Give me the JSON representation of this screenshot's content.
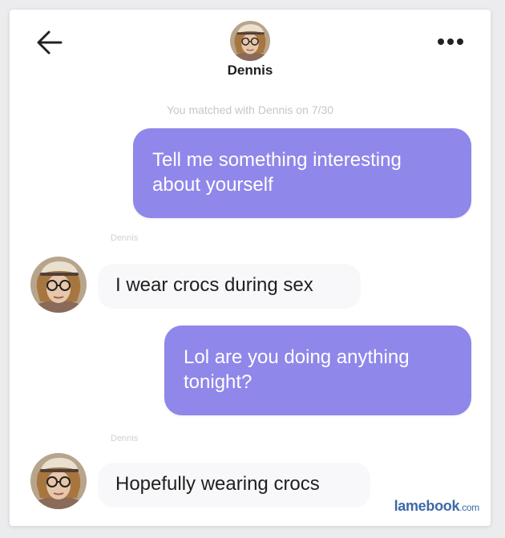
{
  "header": {
    "contact_name": "Dennis",
    "back_icon": "arrow-left-icon",
    "menu_icon": "more-horizontal-icon"
  },
  "chat": {
    "match_note": "You matched with Dennis on 7/30",
    "messages": [
      {
        "from": "me",
        "text": "Tell me something interesting about yourself"
      },
      {
        "from": "Dennis",
        "sender_label": "Dennis",
        "text": "I wear crocs during sex"
      },
      {
        "from": "me",
        "text": "Lol are you doing anything tonight?"
      },
      {
        "from": "Dennis",
        "sender_label": "Dennis",
        "text": "Hopefully wearing crocs"
      }
    ]
  },
  "watermark": {
    "main": "lamebook",
    "tld": ".com"
  },
  "colors": {
    "outgoing_bubble": "#8f87ea",
    "incoming_bubble": "#f8f8fa",
    "watermark": "#3c6aa6"
  }
}
